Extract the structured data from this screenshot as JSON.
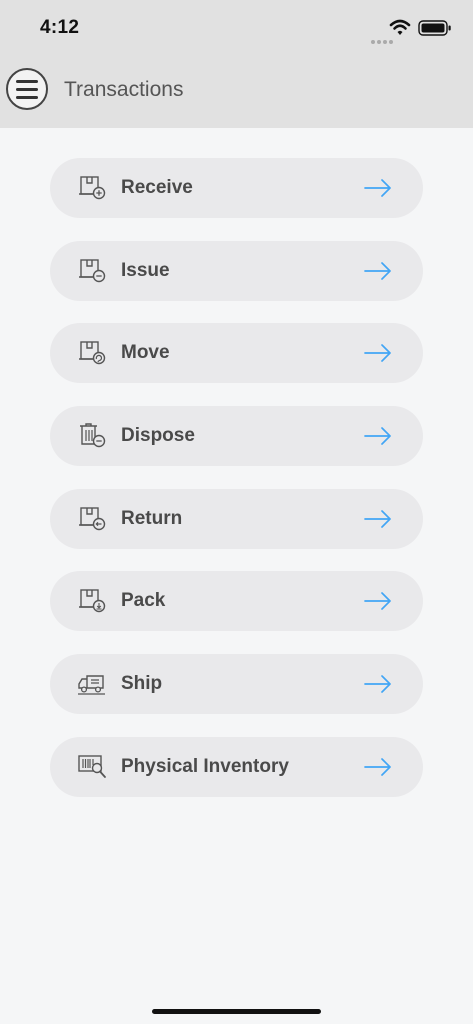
{
  "status_bar": {
    "time": "4:12"
  },
  "header": {
    "title": "Transactions"
  },
  "colors": {
    "arrow": "#42a5f5",
    "pill": "#e9e9eb",
    "header_bg": "#e1e1e1"
  },
  "menu_items": [
    {
      "label": "Receive",
      "icon": "box-add-icon"
    },
    {
      "label": "Issue",
      "icon": "box-minus-icon"
    },
    {
      "label": "Move",
      "icon": "box-move-icon"
    },
    {
      "label": "Dispose",
      "icon": "trash-minus-icon"
    },
    {
      "label": "Return",
      "icon": "box-return-icon"
    },
    {
      "label": "Pack",
      "icon": "box-pack-icon"
    },
    {
      "label": "Ship",
      "icon": "truck-icon"
    },
    {
      "label": "Physical Inventory",
      "icon": "barcode-search-icon"
    }
  ]
}
